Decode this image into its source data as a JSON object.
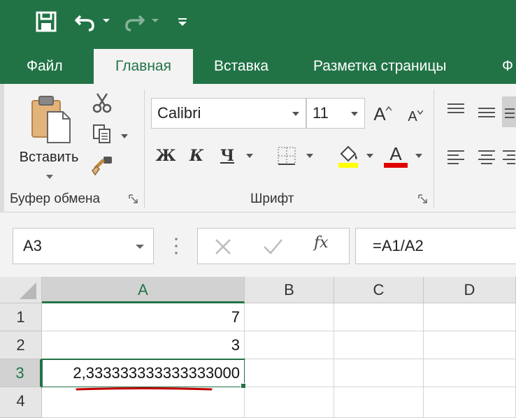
{
  "tabs": [
    {
      "label": "Файл",
      "active": false
    },
    {
      "label": "Главная",
      "active": true
    },
    {
      "label": "Вставка",
      "active": false
    },
    {
      "label": "Разметка страницы",
      "active": false
    },
    {
      "label": "Ф",
      "active": false
    }
  ],
  "quick_access": {
    "icons": [
      "save-icon",
      "undo-icon",
      "redo-icon",
      "customize-icon"
    ]
  },
  "ribbon": {
    "clipboard": {
      "paste_label": "Вставить",
      "group_label": "Буфер обмена"
    },
    "font": {
      "font_name": "Calibri",
      "font_size": "11",
      "grow_label": "A",
      "shrink_label": "A",
      "bold_label": "Ж",
      "italic_label": "К",
      "underline_label": "Ч",
      "color_label": "A",
      "group_label": "Шрифт",
      "fill_color": "#ffff00",
      "font_color": "#e00000"
    }
  },
  "formula_bar": {
    "name_box": "A3",
    "fx_label": "fx",
    "formula": "=A1/A2"
  },
  "sheet": {
    "columns": [
      "A",
      "B",
      "C",
      "D"
    ],
    "rows": [
      "1",
      "2",
      "3",
      "4"
    ],
    "cells": {
      "A1": "7",
      "A2": "3",
      "A3": "2,333333333333333000"
    },
    "active_cell": "A3",
    "accent": "#217346",
    "annotation_color": "#c00000"
  }
}
